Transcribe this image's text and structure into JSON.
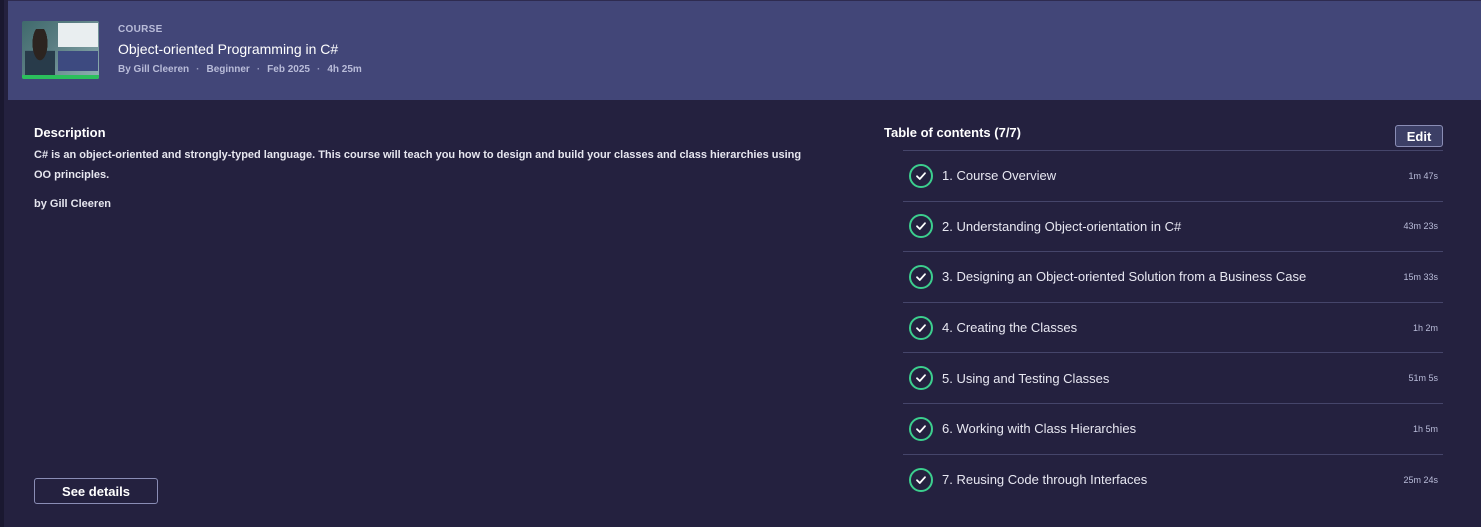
{
  "header": {
    "label": "COURSE",
    "title": "Object-oriented Programming in C#",
    "author": "By Gill Cleeren",
    "level": "Beginner",
    "date": "Feb 2025",
    "duration": "4h 25m",
    "separator": "·",
    "thumbnail_icon": "course-thumbnail-image"
  },
  "description": {
    "heading": "Description",
    "text": "C# is an object-oriented and strongly-typed language. This course will teach you how to design and build your classes and class hierarchies using OO principles.",
    "author": "by Gill Cleeren",
    "see_details_label": "See details"
  },
  "toc": {
    "heading": "Table of contents (7/7)",
    "edit_label": "Edit",
    "items": [
      {
        "title": "1. Course Overview",
        "duration": "1m 47s",
        "completed": true
      },
      {
        "title": "2. Understanding Object-orientation in C#",
        "duration": "43m 23s",
        "completed": true
      },
      {
        "title": "3. Designing an Object-oriented Solution from a Business Case",
        "duration": "15m 33s",
        "completed": true
      },
      {
        "title": "4. Creating the Classes",
        "duration": "1h 2m",
        "completed": true
      },
      {
        "title": "5. Using and Testing Classes",
        "duration": "51m 5s",
        "completed": true
      },
      {
        "title": "6. Working with Class Hierarchies",
        "duration": "1h 5m",
        "completed": true
      },
      {
        "title": "7. Reusing Code through Interfaces",
        "duration": "25m 24s",
        "completed": true
      }
    ]
  },
  "colors": {
    "header_bg": "#424678",
    "page_bg": "#24213f",
    "check_green": "#3ccf8e",
    "progress_green": "#2bbf5c"
  }
}
